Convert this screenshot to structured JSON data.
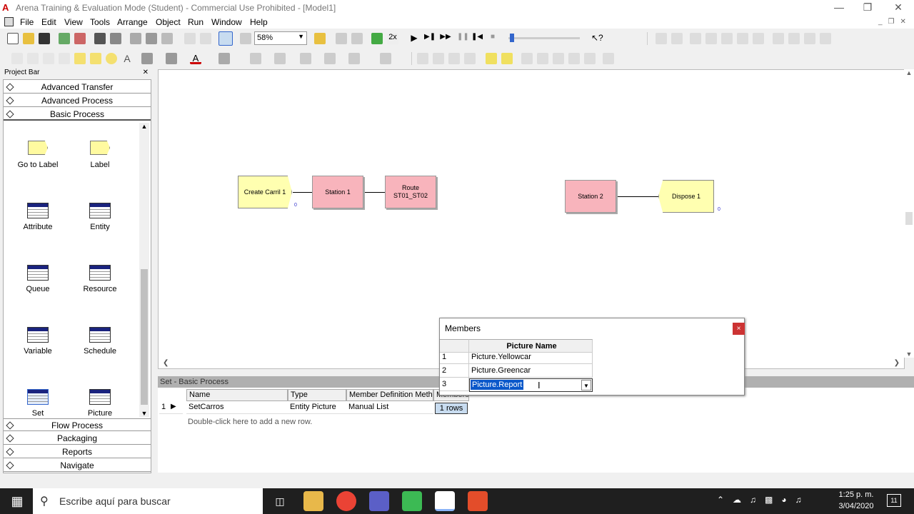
{
  "window": {
    "title": "Arena Training & Evaluation Mode (Student) - Commercial Use Prohibited - [Model1]"
  },
  "menu": [
    "File",
    "Edit",
    "View",
    "Tools",
    "Arrange",
    "Object",
    "Run",
    "Window",
    "Help"
  ],
  "toolbar": {
    "zoom": "58%"
  },
  "project_bar": {
    "title": "Project Bar",
    "panels_top": [
      "Advanced Transfer",
      "Advanced Process",
      "Basic Process"
    ],
    "tiles": [
      "Go to Label",
      "Label",
      "Attribute",
      "Entity",
      "Queue",
      "Resource",
      "Variable",
      "Schedule",
      "Set",
      "Picture"
    ],
    "panels_bottom": [
      "Flow Process",
      "Packaging",
      "Reports",
      "Navigate"
    ]
  },
  "canvas": {
    "modules": [
      "Create Carril 1",
      "Station 1",
      "Route ST01_ST02",
      "Station 2",
      "Dispose 1"
    ],
    "counters": [
      "0",
      "0"
    ]
  },
  "spreadsheet": {
    "title": "Set - Basic Process",
    "columns": [
      "Name",
      "Type",
      "Member Definition Method",
      "Members"
    ],
    "row": {
      "num": "1",
      "name": "SetCarros",
      "type": "Entity Picture",
      "method": "Manual List",
      "members": "1 rows"
    },
    "add_row_hint": "Double-click here to add a new row."
  },
  "dialog": {
    "title": "Members",
    "close": "×",
    "column": "Picture Name",
    "rows": [
      {
        "num": "1",
        "name": "Picture.Yellowcar"
      },
      {
        "num": "2",
        "name": "Picture.Greencar"
      },
      {
        "num": "3",
        "name": "Picture.Report"
      }
    ]
  },
  "taskbar": {
    "search_placeholder": "Escribe aquí para buscar",
    "time": "1:25 p. m.",
    "date": "3/04/2020",
    "notifications": "11"
  }
}
